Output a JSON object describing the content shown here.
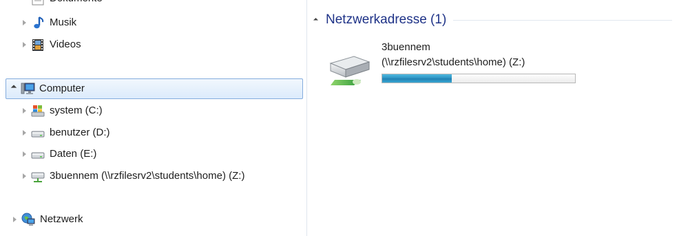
{
  "nav": {
    "items": [
      {
        "label": "Dokumente",
        "icon": "documents-icon",
        "state": "collapsed"
      },
      {
        "label": "Musik",
        "icon": "music-icon",
        "state": "collapsed"
      },
      {
        "label": "Videos",
        "icon": "videos-icon",
        "state": "collapsed"
      },
      {
        "label": "Computer",
        "icon": "computer-icon",
        "state": "expanded",
        "selected": true
      },
      {
        "label": "system (C:)",
        "icon": "system-drive-icon",
        "state": "collapsed"
      },
      {
        "label": "benutzer (D:)",
        "icon": "drive-icon",
        "state": "collapsed"
      },
      {
        "label": "Daten (E:)",
        "icon": "drive-icon",
        "state": "collapsed"
      },
      {
        "label": "3buennem (\\\\rzfilesrv2\\students\\home) (Z:)",
        "icon": "network-drive-icon",
        "state": "collapsed"
      },
      {
        "label": "Netzwerk",
        "icon": "network-icon",
        "state": "collapsed"
      }
    ]
  },
  "content": {
    "group_title": "Netzwerkadresse (1)",
    "drive": {
      "name": "3buennem",
      "path": "(\\\\rzfilesrv2\\students\\home) (Z:)",
      "used_fraction": 0.36,
      "icon": "network-drive-large-icon"
    }
  },
  "colors": {
    "group_title": "#1e3287",
    "selection_border": "#84acdd",
    "bar_fill": "#2a8fc0"
  }
}
